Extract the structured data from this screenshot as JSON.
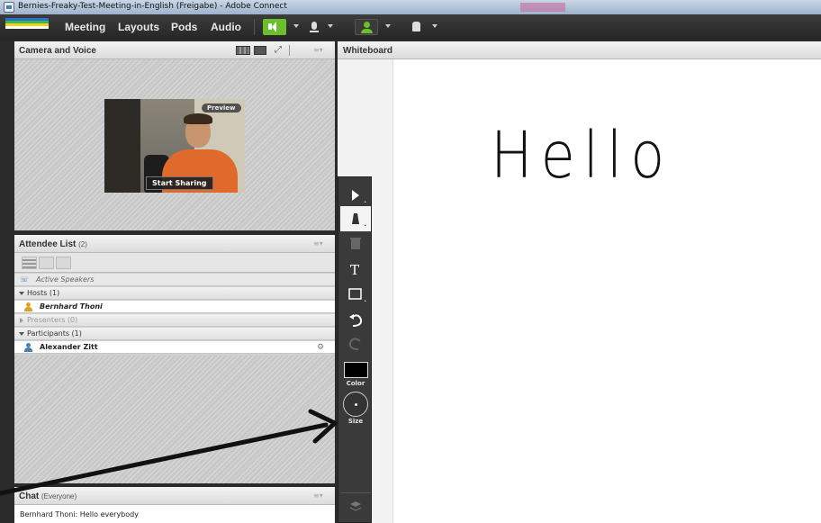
{
  "window": {
    "title": "Bernies-Freaky-Test-Meeting-in-English (Freigabe) - Adobe Connect"
  },
  "menu": {
    "items": [
      "Meeting",
      "Layouts",
      "Pods",
      "Audio"
    ]
  },
  "toolbar": {
    "speaker_icon": "speaker-icon",
    "mic_icon": "microphone-icon",
    "camera_icon": "webcam-person-icon",
    "status_icon": "raise-hand-icon",
    "accent": "#6bbf2a"
  },
  "camera_pod": {
    "title": "Camera and Voice",
    "preview_label": "Preview",
    "start_sharing_label": "Start Sharing"
  },
  "attendee_pod": {
    "title": "Attendee List",
    "count": "(2)",
    "active_speakers": "Active Speakers",
    "groups": {
      "hosts": "Hosts (1)",
      "host_user": "Bernhard Thoni",
      "presenters": "Presenters (0)",
      "participants": "Participants (1)",
      "participant_user": "Alexander Zitt"
    }
  },
  "chat_pod": {
    "title": "Chat",
    "scope": "(Everyone)",
    "message": "Bernhard Thoni: Hello everybody"
  },
  "whiteboard": {
    "title": "Whiteboard",
    "text": "Hello",
    "tools": {
      "color_label": "Color",
      "size_label": "Size",
      "selected_color": "#000000"
    }
  }
}
